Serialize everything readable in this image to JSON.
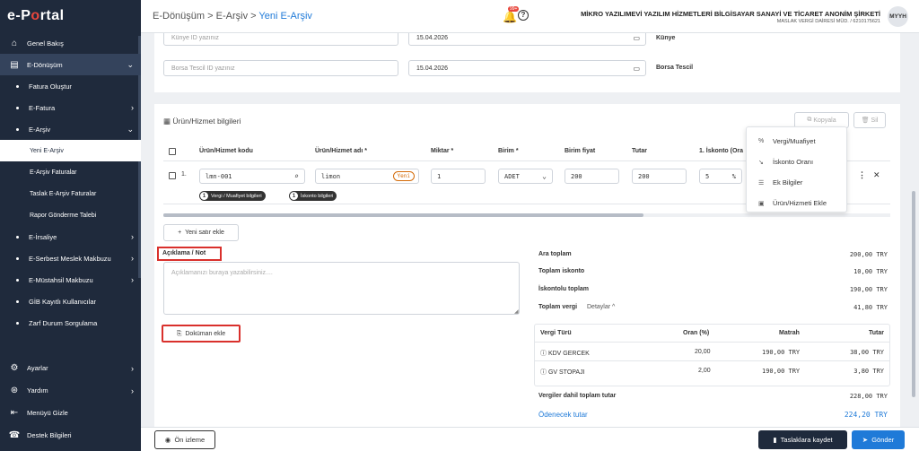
{
  "app": {
    "logo_a": "e-P",
    "logo_b": "o",
    "logo_c": "rtal"
  },
  "sidebar": {
    "items": [
      {
        "label": "Genel Bakış",
        "icon": "home-icon",
        "glyph": "⌂"
      },
      {
        "label": "E-Dönüşüm",
        "icon": "document-icon",
        "glyph": "▤",
        "chev": "⌄"
      },
      {
        "label": "Fatura Oluştur"
      },
      {
        "label": "E-Fatura",
        "chev": "›"
      },
      {
        "label": "E-Arşiv",
        "chev": "⌄"
      },
      {
        "label": "Yeni E-Arşiv"
      },
      {
        "label": "E-Arşiv Faturalar"
      },
      {
        "label": "Taslak E-Arşiv Faturalar"
      },
      {
        "label": "Rapor Gönderme Talebi"
      },
      {
        "label": "E-İrsaliye",
        "chev": "›"
      },
      {
        "label": "E-Serbest Meslek Makbuzu",
        "chev": "›"
      },
      {
        "label": "E-Müstahsil Makbuzu",
        "chev": "›"
      },
      {
        "label": "GİB Kayıtlı Kullanıcılar"
      },
      {
        "label": "Zarf Durum Sorgulama"
      },
      {
        "label": "Ayarlar",
        "icon": "gear-icon",
        "glyph": "⚙",
        "chev": "›"
      },
      {
        "label": "Yardım",
        "icon": "lifebuoy-icon",
        "glyph": "⊛",
        "chev": "›"
      },
      {
        "label": "Menüyü Gizle",
        "icon": "collapse-menu-icon",
        "glyph": "⇤"
      },
      {
        "label": "Destek Bilgileri",
        "icon": "support-icon",
        "glyph": "☎"
      }
    ]
  },
  "topbar": {
    "crumb1": "E-Dönüşüm",
    "sep": " > ",
    "crumb2": "E-Arşiv",
    "crumb3": "Yeni E-Arşiv",
    "notif_count": "99+",
    "help": "?",
    "company_name": "MİKRO YAZILIMEVİ YAZILIM HİZMETLERİ BİLGİSAYAR SANAYİ VE TİCARET ANONİM ŞİRKETİ",
    "company_vd": "MASLAK VERGİ DAİRESİ MÜD. / 6210175621",
    "avatar": "MYYH"
  },
  "form": {
    "kunye_placeholder": "Künye ID yazınız",
    "kunye_date": "15.04.2026",
    "kunye_label": "Künye",
    "borsa_placeholder": "Borsa Tescil  ID yazınız",
    "borsa_date": "15.04.2026",
    "borsa_label": "Borsa Tescil"
  },
  "products": {
    "title": "Ürün/Hizmet bilgileri",
    "copy_label": "Kopyala",
    "delete_label": "Sil",
    "columns": [
      "Ürün/Hizmet kodu",
      "Ürün/Hizmet adı *",
      "Miktar *",
      "Birim *",
      "Birim fiyat",
      "Tutar",
      "1. İskonto (Ora"
    ],
    "row": {
      "index": "1.",
      "code": "lmn-001",
      "name": "limon",
      "new_badge": "Yeni",
      "qty": "1",
      "unit": "ADET",
      "price": "200",
      "amount": "200",
      "discount": "5",
      "pct": "%"
    },
    "tag1_num": "1",
    "tag1": "Vergi / Muafiyet bilgileri",
    "tag2_num": "1",
    "tag2": "İskonto bilgileri",
    "add_row": "Yeni satır ekle"
  },
  "popup": {
    "items": [
      {
        "label": "Vergi/Muafiyet",
        "icon": "percent-icon",
        "glyph": "%"
      },
      {
        "label": "İskonto Oranı",
        "icon": "trend-down-icon",
        "glyph": "↘"
      },
      {
        "label": "Ek Bilgiler",
        "icon": "list-icon",
        "glyph": "☰"
      },
      {
        "label": "Ürün/Hizmeti Ekle",
        "icon": "save-icon",
        "glyph": "▣"
      }
    ]
  },
  "note": {
    "label": "Açıklama / Not",
    "placeholder": "Açıklamanızı buraya yazabilirsiniz....",
    "attach": "Doküman ekle"
  },
  "summary": {
    "ara_toplam_k": "Ara toplam",
    "ara_toplam_v": "200,00 TRY",
    "toplam_iskonto_k": "Toplam iskonto",
    "toplam_iskonto_v": "10,00 TRY",
    "iskontolu_k": "İskontolu toplam",
    "iskontolu_v": "190,00 TRY",
    "vergi_k": "Toplam vergi",
    "vergi_detay": "Detaylar ^",
    "vergi_v": "41,80 TRY",
    "tax_table": {
      "headers": [
        "Vergi Türü",
        "Oran (%)",
        "Matrah",
        "Tutar"
      ],
      "rows": [
        [
          "KDV GERCEK",
          "20,00",
          "190,00 TRY",
          "38,00 TRY"
        ],
        [
          "GV STOPAJI",
          "2,00",
          "190,00 TRY",
          "3,80 TRY"
        ]
      ]
    },
    "dahil_k": "Vergiler dahil toplam tutar",
    "dahil_v": "228,00 TRY",
    "odenecek_k": "Ödenecek tutar",
    "odenecek_v": "224,20 TRY"
  },
  "footer": {
    "preview": "Ön izleme",
    "draft": "Taslaklara kaydet",
    "send": "Gönder"
  },
  "colors": {
    "sidebar": "#1f2a3c",
    "accent": "#1f7ad8",
    "highlight": "#d9302c"
  }
}
